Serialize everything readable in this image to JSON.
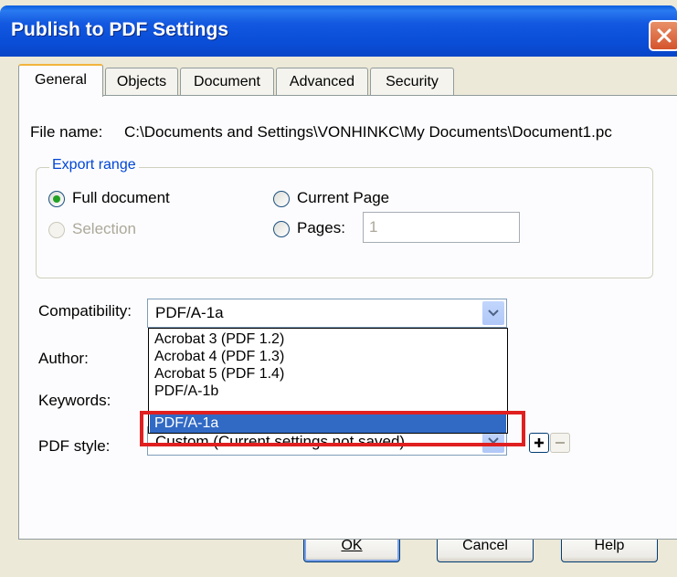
{
  "window": {
    "title": "Publish to PDF Settings"
  },
  "tabs": [
    {
      "label": "General",
      "active": true
    },
    {
      "label": "Objects",
      "active": false
    },
    {
      "label": "Document",
      "active": false
    },
    {
      "label": "Advanced",
      "active": false
    },
    {
      "label": "Security",
      "active": false
    }
  ],
  "general": {
    "file_name_label": "File name:",
    "file_name_value": "C:\\Documents and Settings\\VONHINKC\\My Documents\\Document1.pc",
    "export_range": {
      "legend": "Export range",
      "options": {
        "full_document": {
          "label": "Full document",
          "checked": true,
          "enabled": true
        },
        "current_page": {
          "label": "Current Page",
          "checked": false,
          "enabled": true
        },
        "selection": {
          "label": "Selection",
          "checked": false,
          "enabled": false
        },
        "pages": {
          "label": "Pages:",
          "checked": false,
          "enabled": true
        }
      },
      "pages_value": "1"
    },
    "compatibility": {
      "label": "Compatibility:",
      "value": "PDF/A-1a",
      "options": [
        "Acrobat 3 (PDF 1.2)",
        "Acrobat 4 (PDF 1.3)",
        "Acrobat 5 (PDF 1.4)",
        "PDF/A-1b",
        "PDF/A-1a"
      ],
      "highlighted": "PDF/A-1a"
    },
    "author_label": "Author:",
    "keywords_label": "Keywords:",
    "pdf_style": {
      "label": "PDF style:",
      "value": "Custom (Current settings not saved)"
    }
  },
  "buttons": {
    "ok": "OK",
    "cancel": "Cancel",
    "help": "Help",
    "add": "+",
    "remove": "−"
  },
  "colors": {
    "title_bar": "#0a4ed8",
    "highlight": "#316ac5",
    "annotation_box": "#e02020",
    "legend_text": "#0046d5"
  }
}
